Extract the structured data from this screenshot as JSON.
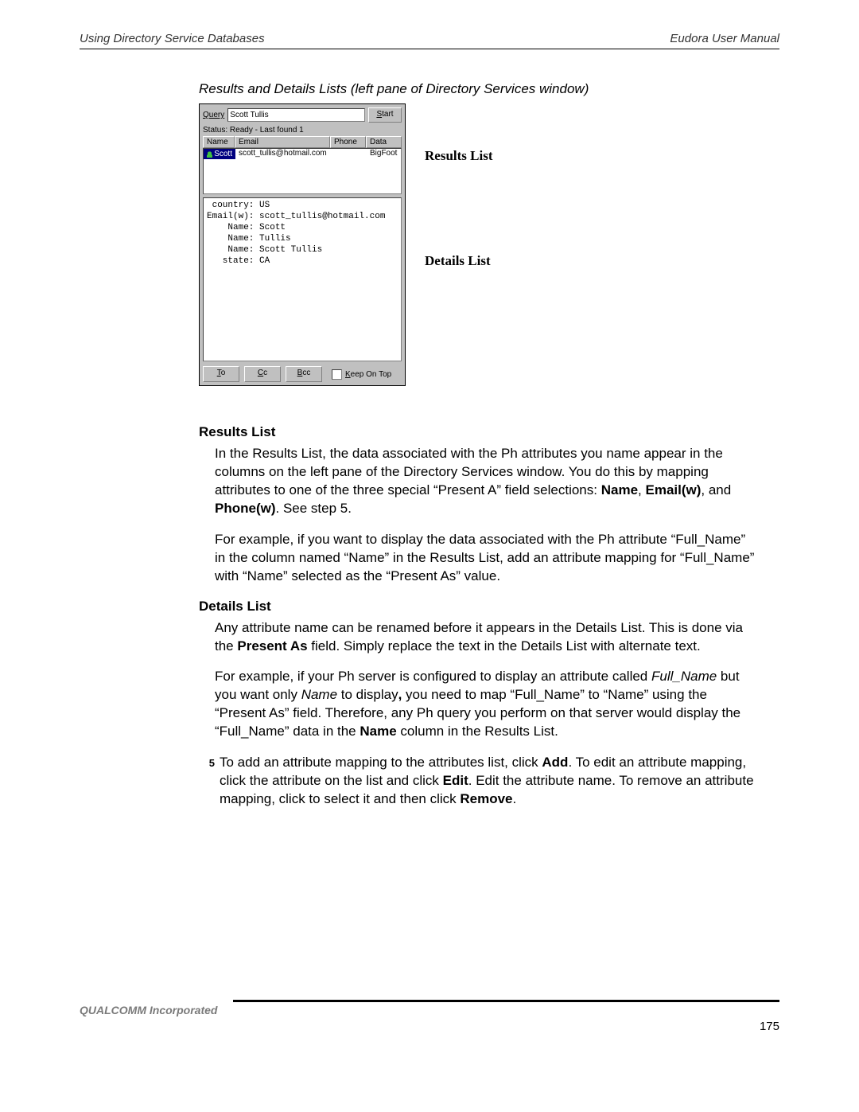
{
  "header": {
    "left": "Using Directory Service Databases",
    "right": "Eudora User Manual"
  },
  "caption": "Results and Details Lists (left pane of Directory Services window)",
  "window": {
    "query_label": "Query",
    "query_value": "Scott Tullis",
    "start_label": "Start",
    "status": "Status: Ready - Last found 1",
    "columns": {
      "name": "Name",
      "email": "Email",
      "phone": "Phone",
      "data": "Data"
    },
    "row": {
      "name": "Scott",
      "email": "scott_tullis@hotmail.com",
      "phone": "",
      "data": "BigFoot"
    },
    "details_text": " country: US\nEmail(w): scott_tullis@hotmail.com\n    Name: Scott\n    Name: Tullis\n    Name: Scott Tullis\n   state: CA",
    "buttons": {
      "to": "To",
      "cc": "Cc",
      "bcc": "Bcc"
    },
    "keep_on_top": "Keep On Top"
  },
  "callouts": {
    "results": "Results List",
    "details": "Details List"
  },
  "sections": {
    "results_header": "Results List",
    "results_p1a": "In the Results List, the data associated with the Ph attributes you name appear in the columns on the left pane of the Directory Services window. You do this by mapping attributes to one of the three special “Present A” field selections: ",
    "name_bold": "Name",
    "comma1": ", ",
    "emailw_bold": "Email(w)",
    "and": ", and ",
    "phonew_bold": "Phone(w)",
    "see_step": ". See step 5.",
    "results_p2": "For example, if you want to display the data associated with the Ph attribute “Full_Name” in the column named “Name” in the Results List, add an attribute mapping for “Full_Name” with “Name” selected as the “Present As” value.",
    "details_header": "Details List",
    "details_p1a": "Any attribute name can be renamed before it appears in the Details List. This is done via the ",
    "present_as_bold": "Present As",
    "details_p1b": " field. Simply replace the text in the Details List with alternate text.",
    "details_p2a": "For example, if your Ph server is configured to display an attribute called ",
    "full_name_italic": "Full_Name",
    "details_p2b": " but you want only ",
    "name_italic": "Name",
    "details_p2c": " to display",
    "comma_bold": ",",
    "details_p2d": " you need to map “Full_Name” to “Name” using the “Present As” field. Therefore, any Ph query you perform on that server would display the “Full_Name” data in the ",
    "name_bold2": "Name",
    "details_p2e": " column in the Results List.",
    "step5_num": "5",
    "step5_a": "To add an attribute mapping to the attributes list, click ",
    "add_bold": "Add",
    "step5_b": ". To edit an attribute mapping, click the attribute on the list and click ",
    "edit_bold": "Edit",
    "step5_c": ". Edit the attribute name. To remove an attribute mapping, click to select it and then click ",
    "remove_bold": "Remove",
    "step5_d": "."
  },
  "footer": {
    "company": "QUALCOMM Incorporated",
    "page": "175"
  }
}
